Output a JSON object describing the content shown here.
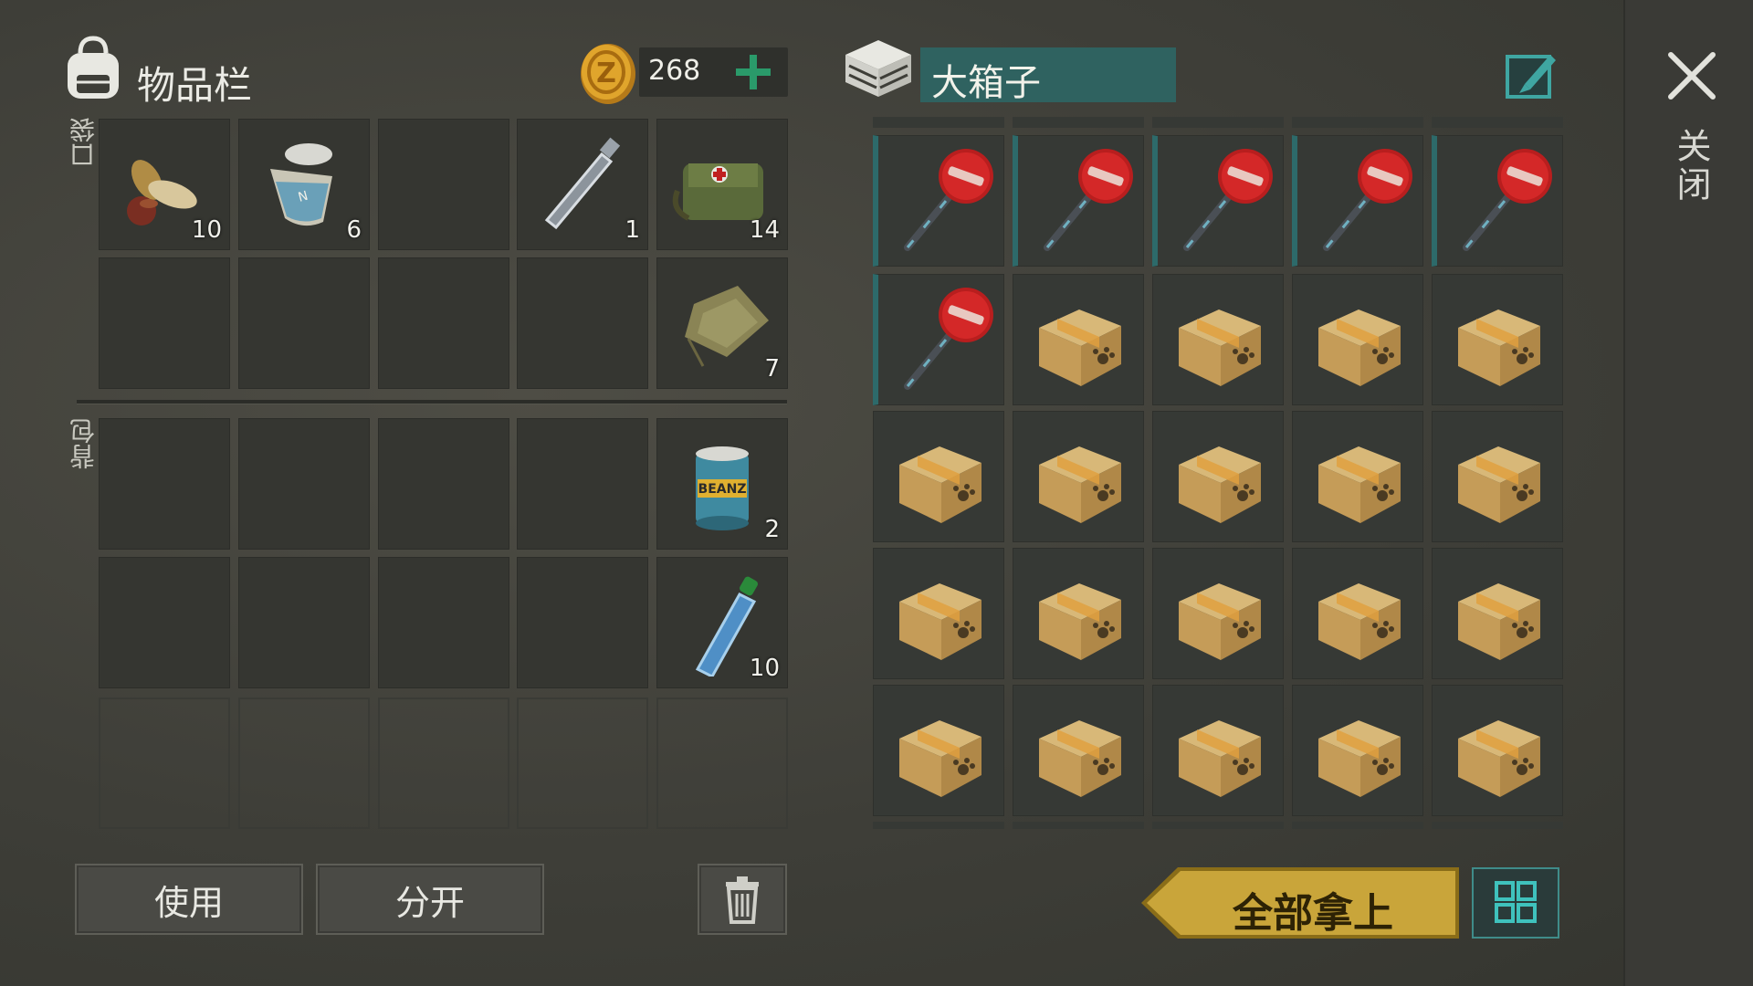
{
  "inventory": {
    "title": "物品栏",
    "coins": "268",
    "pocket_label": "口袋",
    "backpack_label": "背包",
    "pocket_items": [
      {
        "name": "seeds",
        "count": "10"
      },
      {
        "name": "canned-food-open",
        "count": "6"
      },
      {
        "name": "empty",
        "count": ""
      },
      {
        "name": "plastic-bottle-empty",
        "count": "1"
      },
      {
        "name": "first-aid-bag",
        "count": "14"
      },
      {
        "name": "empty",
        "count": ""
      },
      {
        "name": "empty",
        "count": ""
      },
      {
        "name": "empty",
        "count": ""
      },
      {
        "name": "empty",
        "count": ""
      },
      {
        "name": "cloth-rag",
        "count": "7"
      }
    ],
    "backpack_items": [
      {
        "name": "empty",
        "count": ""
      },
      {
        "name": "empty",
        "count": ""
      },
      {
        "name": "empty",
        "count": ""
      },
      {
        "name": "empty",
        "count": ""
      },
      {
        "name": "canned-beans",
        "count": "2"
      },
      {
        "name": "empty",
        "count": ""
      },
      {
        "name": "empty",
        "count": ""
      },
      {
        "name": "empty",
        "count": ""
      },
      {
        "name": "empty",
        "count": ""
      },
      {
        "name": "water-bottle",
        "count": "10"
      }
    ],
    "buttons": {
      "use": "使用",
      "split": "分开"
    }
  },
  "chest": {
    "title": "大箱子",
    "take_all": "全部拿上",
    "rows": [
      [
        "stop-sign",
        "stop-sign",
        "stop-sign",
        "stop-sign",
        "stop-sign"
      ],
      [
        "stop-sign",
        "cardboard-box",
        "cardboard-box",
        "cardboard-box",
        "cardboard-box"
      ],
      [
        "cardboard-box",
        "cardboard-box",
        "cardboard-box",
        "cardboard-box",
        "cardboard-box"
      ],
      [
        "cardboard-box",
        "cardboard-box",
        "cardboard-box",
        "cardboard-box",
        "cardboard-box"
      ],
      [
        "cardboard-box",
        "cardboard-box",
        "cardboard-box",
        "cardboard-box",
        "cardboard-box"
      ]
    ]
  },
  "close_label": "关闭",
  "icons": {
    "bag": "backpack-icon",
    "coin": "coin-icon",
    "plus": "plus-icon",
    "chest": "chest-icon",
    "edit": "edit-icon",
    "close": "close-icon",
    "trash": "trash-icon",
    "grid": "grid-icon"
  },
  "colors": {
    "teal": "#2f6260",
    "gold": "#c9a53a",
    "green_plus": "#2a9a6a"
  }
}
